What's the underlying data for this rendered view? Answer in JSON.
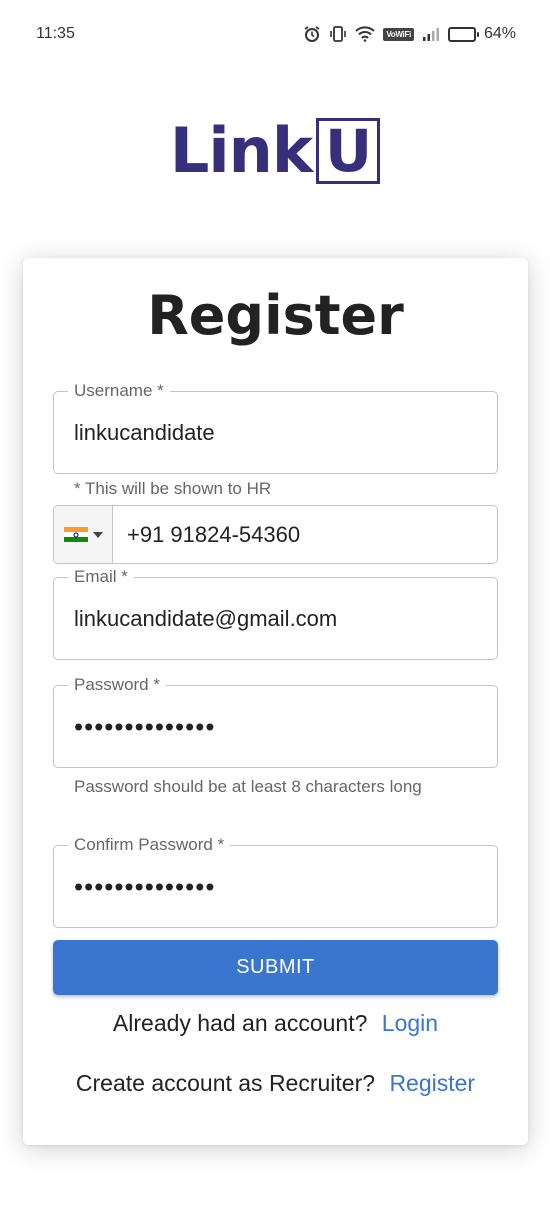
{
  "status_bar": {
    "time": "11:35",
    "icons": [
      "alarm-icon",
      "vibrate-icon",
      "wifi-icon",
      "vowifi-badge",
      "signal-icon",
      "battery-icon"
    ],
    "vowifi_label": "VoWiFi",
    "battery_percent": "64%",
    "battery_level": 0.64
  },
  "logo": {
    "text": "Link",
    "boxed_letter": "U",
    "color": "#36307a"
  },
  "form": {
    "title": "Register",
    "username": {
      "label": "Username *",
      "value": "linkucandidate"
    },
    "username_helper": "* This will be shown to HR",
    "phone": {
      "country": "India",
      "flag_icon": "india-flag-icon",
      "value": "+91 91824-54360"
    },
    "email": {
      "label": "Email *",
      "value": "linkucandidate@gmail.com"
    },
    "password": {
      "label": "Password *",
      "value": "••••••••••••••"
    },
    "password_helper": "Password should be at least 8 characters long",
    "confirm_password": {
      "label": "Confirm Password *",
      "value": "••••••••••••••"
    },
    "submit_label": "SUBMIT",
    "login_prompt": "Already had an account?",
    "login_link": "Login",
    "recruiter_prompt": "Create account as Recruiter?",
    "recruiter_link": "Register"
  },
  "colors": {
    "accent": "#3a75cf",
    "brand": "#36307a",
    "border": "#c4c4c4"
  }
}
